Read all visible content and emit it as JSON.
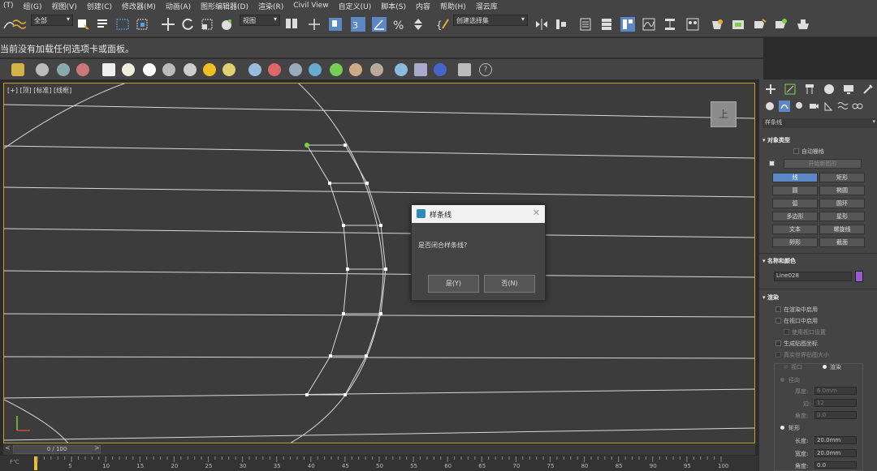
{
  "menu": [
    "(T)",
    "组(G)",
    "视图(V)",
    "创建(C)",
    "修改器(M)",
    "动画(A)",
    "图形编辑器(D)",
    "渲染(R)",
    "Civil View",
    "自定义(U)",
    "脚本(S)",
    "内容",
    "帮助(H)",
    "溜云库"
  ],
  "toolbar": {
    "filter_dropdown": "全部",
    "view_dropdown": "视图",
    "selection_set_dropdown": "创建选择集"
  },
  "message": "当前没有加载任何选项卡或面板。",
  "viewport": {
    "label": "[+] [顶] [标准] [线框]",
    "viewcube_label": "上"
  },
  "dialog": {
    "title": "样条线",
    "message": "是否闭合样条线?",
    "yes_button": "是(Y)",
    "no_button": "否(N)"
  },
  "timeline": {
    "slider": "0 / 100",
    "ticks": [
      "5",
      "10",
      "15",
      "20",
      "25",
      "30",
      "35",
      "40",
      "45",
      "50",
      "55",
      "60",
      "65",
      "70",
      "75",
      "80",
      "85",
      "90",
      "95",
      "100"
    ],
    "current_frame": 0
  },
  "command_panel": {
    "category_dropdown": "样条线",
    "object_type": {
      "header": "对象类型",
      "autogrid": "自动栅格",
      "start_new_shape": "开始新图形",
      "buttons": [
        "线",
        "矩形",
        "圆",
        "椭圆",
        "弧",
        "圆环",
        "多边形",
        "星形",
        "文本",
        "螺旋线",
        "卵形",
        "截面"
      ],
      "active": "线"
    },
    "name_color": {
      "header": "名称和颜色",
      "name": "Line028",
      "color": "#9b59d0"
    },
    "rendering": {
      "header": "渲染",
      "enable_in_renderer": "在渲染中启用",
      "enable_in_viewport": "在视口中启用",
      "use_viewport_settings": "使用视口设置",
      "generate_mapping": "生成贴图坐标",
      "real_world_map_size": "真实世界贴图大小",
      "viewport_radio": "视口",
      "render_radio": "渲染",
      "radial": "径向",
      "thickness_label": "厚度:",
      "thickness": "6.0mm",
      "sides_label": "边:",
      "sides": "12",
      "angle_label": "角度:",
      "angle": "0.0",
      "rectangular": "矩形",
      "length_label": "长度:",
      "length": "20.0mm",
      "width_label": "宽度:",
      "width": "20.0mm",
      "angle2_label": "角度:",
      "angle2": "0.0"
    }
  },
  "colors": {
    "viewport_border": "#cc9a2e",
    "active_button": "#5b87c4",
    "vertex_selected": "#7ad04a"
  }
}
